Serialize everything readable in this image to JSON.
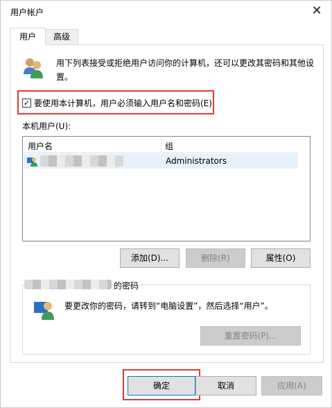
{
  "window": {
    "title": "用户帐户"
  },
  "tabs": [
    {
      "label": "用户"
    },
    {
      "label": "高级"
    }
  ],
  "intro_text": "用下列表接受或拒绝用户访问你的计算机，还可以更改其密码和其他设置。",
  "require_password": {
    "label": "要使用本计算机，用户必须输入用户名和密码(E)",
    "checked": true,
    "checkmark": "✓"
  },
  "local_users_label": "本机用户(U):",
  "users_table": {
    "columns": [
      "用户名",
      "组"
    ],
    "rows": [
      {
        "username": "",
        "group": "Administrators"
      }
    ]
  },
  "user_buttons": {
    "add": "添加(D)...",
    "remove": "删除(R)",
    "properties": "属性(O)"
  },
  "password_group": {
    "legend_suffix": "的密码",
    "text": "要更改你的密码，请转到“电脑设置”，然后选择“用户”。",
    "reset_button": "重置密码(P)..."
  },
  "dialog_buttons": {
    "ok": "确定",
    "cancel": "取消",
    "apply": "应用(A)"
  },
  "colors": {
    "highlight_box": "#e53935",
    "selected_row": "#e5f1fb"
  },
  "icons": {
    "close": "close-icon",
    "users": "users-icon",
    "user": "user-icon",
    "password": "user-password-icon"
  }
}
